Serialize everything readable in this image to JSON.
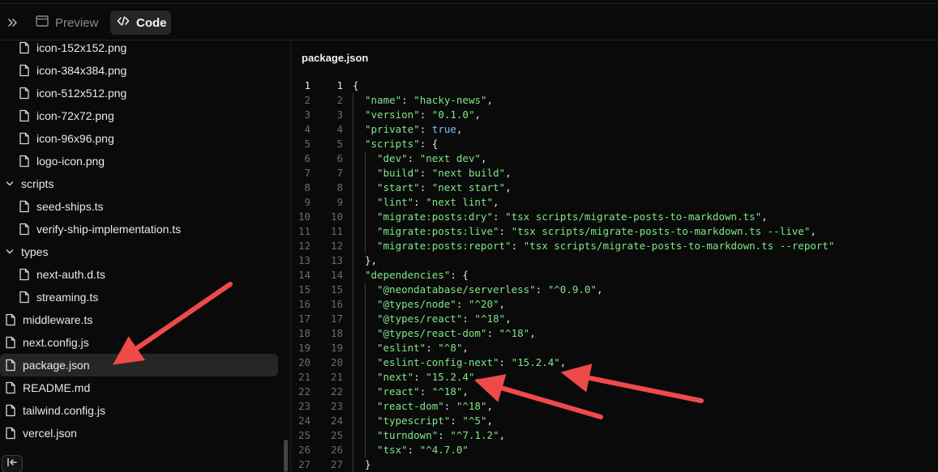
{
  "toolbar": {
    "expand_icon": "chevrons-right-icon",
    "preview_label": "Preview",
    "code_label": "Code"
  },
  "sidebar": {
    "items": [
      {
        "label": "icon-152x152.png",
        "kind": "file",
        "depth": 1
      },
      {
        "label": "icon-384x384.png",
        "kind": "file",
        "depth": 1
      },
      {
        "label": "icon-512x512.png",
        "kind": "file",
        "depth": 1
      },
      {
        "label": "icon-72x72.png",
        "kind": "file",
        "depth": 1
      },
      {
        "label": "icon-96x96.png",
        "kind": "file",
        "depth": 1
      },
      {
        "label": "logo-icon.png",
        "kind": "file",
        "depth": 1
      },
      {
        "label": "scripts",
        "kind": "folder",
        "depth": 0
      },
      {
        "label": "seed-ships.ts",
        "kind": "file",
        "depth": 1
      },
      {
        "label": "verify-ship-implementation.ts",
        "kind": "file",
        "depth": 1
      },
      {
        "label": "types",
        "kind": "folder",
        "depth": 0
      },
      {
        "label": "next-auth.d.ts",
        "kind": "file",
        "depth": 1
      },
      {
        "label": "streaming.ts",
        "kind": "file",
        "depth": 1
      },
      {
        "label": "middleware.ts",
        "kind": "file",
        "depth": 0
      },
      {
        "label": "next.config.js",
        "kind": "file",
        "depth": 0
      },
      {
        "label": "package.json",
        "kind": "file",
        "depth": 0,
        "selected": true
      },
      {
        "label": "README.md",
        "kind": "file",
        "depth": 0
      },
      {
        "label": "tailwind.config.js",
        "kind": "file",
        "depth": 0
      },
      {
        "label": "vercel.json",
        "kind": "file",
        "depth": 0
      }
    ]
  },
  "editor": {
    "filename": "package.json",
    "lines": [
      {
        "n": "1",
        "indent": 0,
        "t": [
          [
            "p",
            "{"
          ]
        ]
      },
      {
        "n": "2",
        "indent": 1,
        "t": [
          [
            "k",
            "\"name\""
          ],
          [
            "p",
            ": "
          ],
          [
            "s",
            "\"hacky-news\""
          ],
          [
            "p",
            ","
          ]
        ]
      },
      {
        "n": "3",
        "indent": 1,
        "t": [
          [
            "k",
            "\"version\""
          ],
          [
            "p",
            ": "
          ],
          [
            "s",
            "\"0.1.0\""
          ],
          [
            "p",
            ","
          ]
        ]
      },
      {
        "n": "4",
        "indent": 1,
        "t": [
          [
            "k",
            "\"private\""
          ],
          [
            "p",
            ": "
          ],
          [
            "b",
            "true"
          ],
          [
            "p",
            ","
          ]
        ]
      },
      {
        "n": "5",
        "indent": 1,
        "t": [
          [
            "k",
            "\"scripts\""
          ],
          [
            "p",
            ": {"
          ]
        ]
      },
      {
        "n": "6",
        "indent": 2,
        "t": [
          [
            "k",
            "\"dev\""
          ],
          [
            "p",
            ": "
          ],
          [
            "s",
            "\"next dev\""
          ],
          [
            "p",
            ","
          ]
        ]
      },
      {
        "n": "7",
        "indent": 2,
        "t": [
          [
            "k",
            "\"build\""
          ],
          [
            "p",
            ": "
          ],
          [
            "s",
            "\"next build\""
          ],
          [
            "p",
            ","
          ]
        ]
      },
      {
        "n": "8",
        "indent": 2,
        "t": [
          [
            "k",
            "\"start\""
          ],
          [
            "p",
            ": "
          ],
          [
            "s",
            "\"next start\""
          ],
          [
            "p",
            ","
          ]
        ]
      },
      {
        "n": "9",
        "indent": 2,
        "t": [
          [
            "k",
            "\"lint\""
          ],
          [
            "p",
            ": "
          ],
          [
            "s",
            "\"next lint\""
          ],
          [
            "p",
            ","
          ]
        ]
      },
      {
        "n": "10",
        "indent": 2,
        "t": [
          [
            "k",
            "\"migrate:posts:dry\""
          ],
          [
            "p",
            ": "
          ],
          [
            "s",
            "\"tsx scripts/migrate-posts-to-markdown.ts\""
          ],
          [
            "p",
            ","
          ]
        ]
      },
      {
        "n": "11",
        "indent": 2,
        "t": [
          [
            "k",
            "\"migrate:posts:live\""
          ],
          [
            "p",
            ": "
          ],
          [
            "s",
            "\"tsx scripts/migrate-posts-to-markdown.ts --live\""
          ],
          [
            "p",
            ","
          ]
        ]
      },
      {
        "n": "12",
        "indent": 2,
        "t": [
          [
            "k",
            "\"migrate:posts:report\""
          ],
          [
            "p",
            ": "
          ],
          [
            "s",
            "\"tsx scripts/migrate-posts-to-markdown.ts --report\""
          ]
        ]
      },
      {
        "n": "13",
        "indent": 1,
        "t": [
          [
            "p",
            "},"
          ]
        ]
      },
      {
        "n": "14",
        "indent": 1,
        "t": [
          [
            "k",
            "\"dependencies\""
          ],
          [
            "p",
            ": {"
          ]
        ]
      },
      {
        "n": "15",
        "indent": 2,
        "t": [
          [
            "k",
            "\"@neondatabase/serverless\""
          ],
          [
            "p",
            ": "
          ],
          [
            "s",
            "\"^0.9.0\""
          ],
          [
            "p",
            ","
          ]
        ]
      },
      {
        "n": "16",
        "indent": 2,
        "t": [
          [
            "k",
            "\"@types/node\""
          ],
          [
            "p",
            ": "
          ],
          [
            "s",
            "\"^20\""
          ],
          [
            "p",
            ","
          ]
        ]
      },
      {
        "n": "17",
        "indent": 2,
        "t": [
          [
            "k",
            "\"@types/react\""
          ],
          [
            "p",
            ": "
          ],
          [
            "s",
            "\"^18\""
          ],
          [
            "p",
            ","
          ]
        ]
      },
      {
        "n": "18",
        "indent": 2,
        "t": [
          [
            "k",
            "\"@types/react-dom\""
          ],
          [
            "p",
            ": "
          ],
          [
            "s",
            "\"^18\""
          ],
          [
            "p",
            ","
          ]
        ]
      },
      {
        "n": "19",
        "indent": 2,
        "t": [
          [
            "k",
            "\"eslint\""
          ],
          [
            "p",
            ": "
          ],
          [
            "s",
            "\"^8\""
          ],
          [
            "p",
            ","
          ]
        ]
      },
      {
        "n": "20",
        "indent": 2,
        "t": [
          [
            "k",
            "\"eslint-config-next\""
          ],
          [
            "p",
            ": "
          ],
          [
            "s",
            "\"15.2.4\""
          ],
          [
            "p",
            ","
          ]
        ]
      },
      {
        "n": "21",
        "indent": 2,
        "t": [
          [
            "k",
            "\"next\""
          ],
          [
            "p",
            ": "
          ],
          [
            "s",
            "\"15.2.4\""
          ],
          [
            "p",
            ","
          ]
        ]
      },
      {
        "n": "22",
        "indent": 2,
        "t": [
          [
            "k",
            "\"react\""
          ],
          [
            "p",
            ": "
          ],
          [
            "s",
            "\"^18\""
          ],
          [
            "p",
            ","
          ]
        ]
      },
      {
        "n": "23",
        "indent": 2,
        "t": [
          [
            "k",
            "\"react-dom\""
          ],
          [
            "p",
            ": "
          ],
          [
            "s",
            "\"^18\""
          ],
          [
            "p",
            ","
          ]
        ]
      },
      {
        "n": "24",
        "indent": 2,
        "t": [
          [
            "k",
            "\"typescript\""
          ],
          [
            "p",
            ": "
          ],
          [
            "s",
            "\"^5\""
          ],
          [
            "p",
            ","
          ]
        ]
      },
      {
        "n": "25",
        "indent": 2,
        "t": [
          [
            "k",
            "\"turndown\""
          ],
          [
            "p",
            ": "
          ],
          [
            "s",
            "\"^7.1.2\""
          ],
          [
            "p",
            ","
          ]
        ]
      },
      {
        "n": "26",
        "indent": 2,
        "t": [
          [
            "k",
            "\"tsx\""
          ],
          [
            "p",
            ": "
          ],
          [
            "s",
            "\"^4.7.0\""
          ]
        ]
      },
      {
        "n": "27",
        "indent": 1,
        "t": [
          [
            "p",
            "}"
          ]
        ]
      }
    ]
  },
  "colors": {
    "background": "#0a0a0a",
    "selected": "#262626",
    "string": "#7ee787",
    "boolean": "#79c0ff",
    "line_number": "#6b6b6b",
    "annotation_arrow": "#ef4a4a"
  }
}
